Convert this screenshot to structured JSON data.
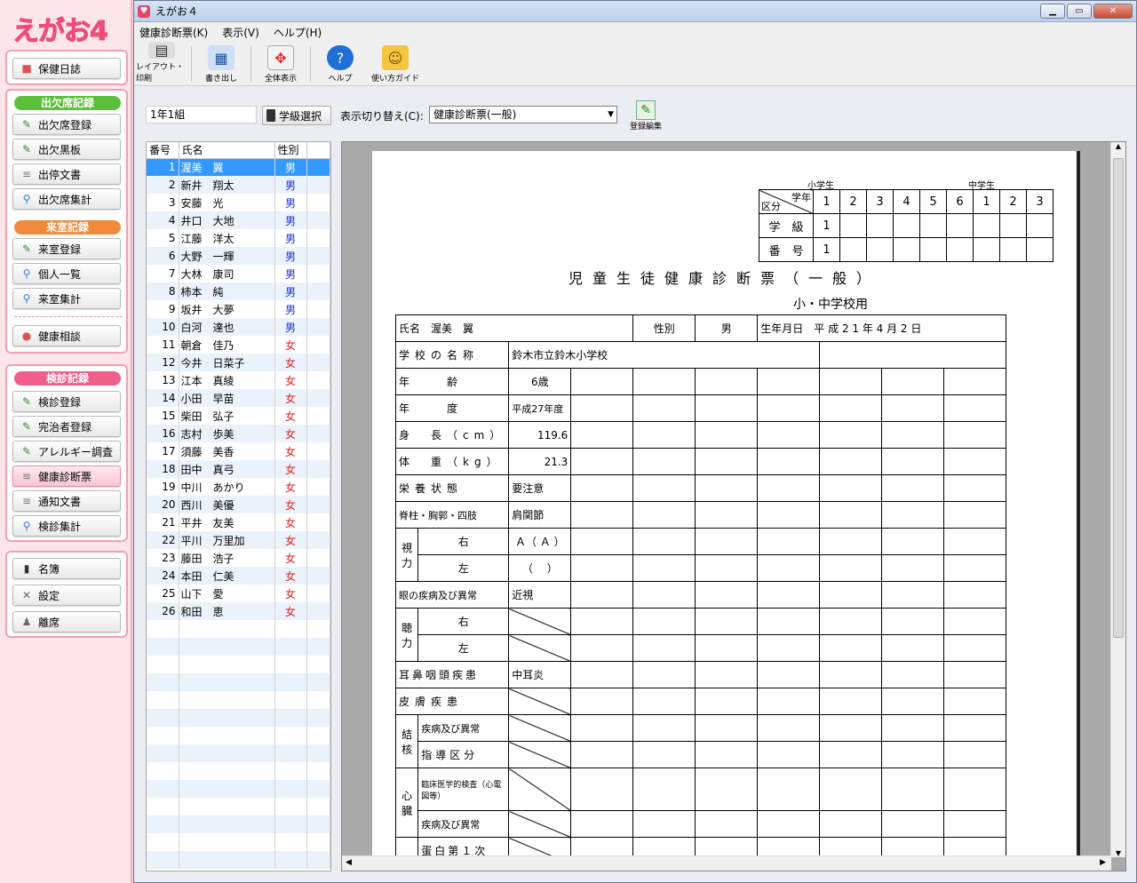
{
  "app": {
    "logo": "えがお4",
    "title": "えがお４"
  },
  "sidebar": {
    "top": {
      "health_diary": "保健日誌"
    },
    "attendance": {
      "header": "出欠席記録",
      "items": [
        "出欠席登録",
        "出欠黒板",
        "出停文書",
        "出欠席集計"
      ]
    },
    "visit": {
      "header": "来室記録",
      "items": [
        "来室登録",
        "個人一覧",
        "来室集計"
      ]
    },
    "consult": "健康相談",
    "checkup": {
      "header": "検診記録",
      "items": [
        "検診登録",
        "完治者登録",
        "アレルギー調査",
        "健康診断票",
        "通知文書",
        "検診集計"
      ]
    },
    "bottom": [
      "名簿",
      "設定",
      "離席"
    ]
  },
  "menu": [
    "健康診断票(K)",
    "表示(V)",
    "ヘルプ(H)"
  ],
  "toolbar": [
    {
      "label": "レイアウト・印刷",
      "icon": "printer-icon"
    },
    {
      "label": "書き出し",
      "icon": "export-icon"
    },
    {
      "label": "全体表示",
      "icon": "fit-view-icon"
    },
    {
      "label": "ヘルプ",
      "icon": "help-icon"
    },
    {
      "label": "使い方ガイド",
      "icon": "guide-icon"
    }
  ],
  "filter": {
    "class_value": "1年1組",
    "class_button": "学級選択",
    "switch_label": "表示切り替え(C):",
    "switch_value": "健康診断票(一般)",
    "edit_button": "登録編集"
  },
  "list": {
    "headers": [
      "番号",
      "氏名",
      "性別"
    ],
    "rows": [
      [
        "1",
        "渥美　翼",
        "男"
      ],
      [
        "2",
        "新井　翔太",
        "男"
      ],
      [
        "3",
        "安藤　光",
        "男"
      ],
      [
        "4",
        "井口　大地",
        "男"
      ],
      [
        "5",
        "江藤　洋太",
        "男"
      ],
      [
        "6",
        "大野　一輝",
        "男"
      ],
      [
        "7",
        "大林　康司",
        "男"
      ],
      [
        "8",
        "柿本　純",
        "男"
      ],
      [
        "9",
        "坂井　大夢",
        "男"
      ],
      [
        "10",
        "白河　達也",
        "男"
      ],
      [
        "11",
        "朝倉　佳乃",
        "女"
      ],
      [
        "12",
        "今井　日菜子",
        "女"
      ],
      [
        "13",
        "江本　真綾",
        "女"
      ],
      [
        "14",
        "小田　早苗",
        "女"
      ],
      [
        "15",
        "柴田　弘子",
        "女"
      ],
      [
        "16",
        "志村　歩美",
        "女"
      ],
      [
        "17",
        "須藤　美香",
        "女"
      ],
      [
        "18",
        "田中　真弓",
        "女"
      ],
      [
        "19",
        "中川　あかり",
        "女"
      ],
      [
        "20",
        "西川　美優",
        "女"
      ],
      [
        "21",
        "平井　友美",
        "女"
      ],
      [
        "22",
        "平川　万里加",
        "女"
      ],
      [
        "23",
        "藤田　浩子",
        "女"
      ],
      [
        "24",
        "本田　仁美",
        "女"
      ],
      [
        "25",
        "山下　愛",
        "女"
      ],
      [
        "26",
        "和田　恵",
        "女"
      ]
    ]
  },
  "doc": {
    "grade_hdr_elem": "小学生",
    "grade_hdr_jr": "中学生",
    "grade_corner_top": "学年",
    "grade_corner_bottom": "区分",
    "grades": [
      "1",
      "2",
      "3",
      "4",
      "5",
      "6",
      "1",
      "2",
      "3"
    ],
    "row_class": "学　級",
    "row_class_val": "1",
    "row_num": "番　号",
    "row_num_val": "1",
    "title": "児童生徒健康診断票（一般）",
    "subtitle": "小・中学校用",
    "name_label": "氏名",
    "name_val": "渥美　翼",
    "sex_label": "性別",
    "sex_val": "男",
    "dob_label": "生年月日",
    "dob_val": "平 成 2 1 年 4 月 2 日",
    "rows": [
      {
        "label": "学校の名称",
        "val": "鈴木市立鈴木小学校"
      },
      {
        "label": "年　　齢",
        "val": "6歳"
      },
      {
        "label": "年　　度",
        "val": "平成27年度"
      },
      {
        "label": "身　長（cm）",
        "val": "119.6"
      },
      {
        "label": "体　重（kg）",
        "val": "21.3"
      },
      {
        "label": "栄養状態",
        "val": "要注意"
      },
      {
        "label": "脊柱・胸郭・四肢",
        "val": "肩関節"
      },
      {
        "label": "右",
        "val": "Ａ（ Ａ ）"
      },
      {
        "label": "左",
        "val": "（　 ）"
      },
      {
        "label": "眼の疾病及び異常",
        "val": "近視"
      },
      {
        "label": "右",
        "val": ""
      },
      {
        "label": "左",
        "val": ""
      },
      {
        "label": "耳鼻咽頭疾患",
        "val": "中耳炎"
      },
      {
        "label": "皮膚疾患",
        "val": ""
      },
      {
        "label": "疾病及び異常",
        "val": ""
      },
      {
        "label": "指導区分",
        "val": ""
      },
      {
        "label": "臨床医学的検査（心電図等）",
        "val": ""
      },
      {
        "label": "疾病及び異常",
        "val": ""
      },
      {
        "label": "蛋白第１次",
        "val": ""
      }
    ],
    "vision": "視力",
    "hearing": "聴力",
    "tb": "結核",
    "heart": "心臓"
  }
}
